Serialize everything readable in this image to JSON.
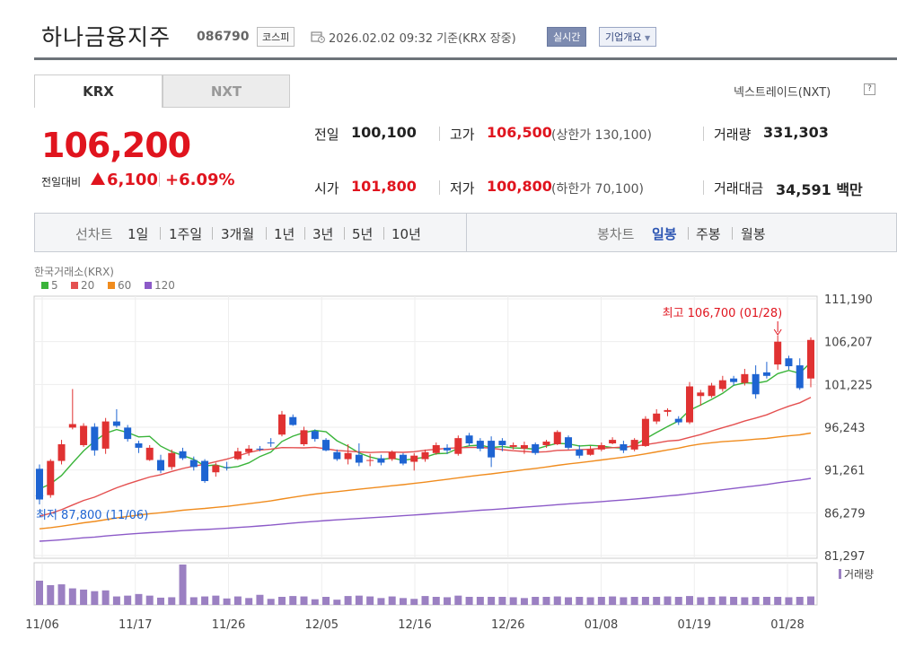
{
  "header": {
    "company": "하나금융지주",
    "code": "086790",
    "market": "코스피",
    "timestamp": "2026.02.02 09:32 기준(KRX 장중)",
    "realtime": "실시간",
    "overview": "기업개요"
  },
  "tabs": {
    "krx": "KRX",
    "nxt": "NXT"
  },
  "nxt_link": "넥스트레이드(NXT)",
  "nxt_help": "?",
  "price": {
    "current": "106,200",
    "change_label": "전일대비",
    "change": "6,100",
    "change_pct": "+6.09%"
  },
  "stats": {
    "prev_label": "전일",
    "prev": "100,100",
    "open_label": "시가",
    "open": "101,800",
    "high_label": "고가",
    "high": "106,500",
    "upper_limit": "(상한가 130,100)",
    "low_label": "저가",
    "low": "100,800",
    "lower_limit": "(하한가 70,100)",
    "volume_label": "거래량",
    "volume": "331,303",
    "amount_label": "거래대금",
    "amount": "34,591",
    "amount_unit": "백만"
  },
  "periods": {
    "line_label": "선차트",
    "items": [
      "1일",
      "1주일",
      "3개월",
      "1년",
      "3년",
      "5년",
      "10년"
    ],
    "candle_label": "봉차트",
    "candle_items": [
      "일봉",
      "주봉",
      "월봉"
    ]
  },
  "chart_data": {
    "type": "candlestick",
    "source": "한국거래소(KRX)",
    "legend": [
      {
        "name": "5",
        "color": "#3ab43a"
      },
      {
        "name": "20",
        "color": "#e45050"
      },
      {
        "name": "60",
        "color": "#f08c1e"
      },
      {
        "name": "120",
        "color": "#8c5ac8"
      }
    ],
    "y_ticks": [
      "111,190",
      "106,207",
      "101,225",
      "96,243",
      "91,261",
      "86,279",
      "81,297"
    ],
    "ylim": [
      81297,
      111190
    ],
    "x_labels": [
      "11/06",
      "11/17",
      "11/26",
      "12/05",
      "12/16",
      "12/26",
      "01/08",
      "01/19",
      "01/28"
    ],
    "high_annotation": "최고 106,700 (01/28)",
    "low_annotation": "최저 87,800 (11/06)",
    "volume_label": "거래량",
    "candles": [
      [
        91500,
        88000,
        92000,
        87800
      ],
      [
        88500,
        92400,
        92600,
        88200
      ],
      [
        92400,
        94300,
        94800,
        92000
      ],
      [
        96200,
        96600,
        100600,
        96000
      ],
      [
        94200,
        96400,
        96700,
        94000
      ],
      [
        96300,
        93600,
        96700,
        93000
      ],
      [
        93800,
        96900,
        97300,
        93200
      ],
      [
        96900,
        96400,
        98300,
        96200
      ],
      [
        96200,
        94900,
        96500,
        94600
      ],
      [
        94400,
        93900,
        94700,
        93300
      ],
      [
        92500,
        93900,
        94200,
        92400
      ],
      [
        92500,
        91300,
        93100,
        91000
      ],
      [
        91700,
        93300,
        93700,
        91400
      ],
      [
        93500,
        92700,
        93900,
        92500
      ],
      [
        92500,
        91700,
        92900,
        91300
      ],
      [
        92400,
        90100,
        92600,
        89900
      ],
      [
        91100,
        91900,
        92200,
        90600
      ],
      [
        91700,
        91600,
        92300,
        91300
      ],
      [
        92600,
        93500,
        93900,
        92500
      ],
      [
        93400,
        93800,
        94200,
        93000
      ],
      [
        93800,
        93700,
        94100,
        93500
      ],
      [
        94500,
        94400,
        95000,
        94000
      ],
      [
        95400,
        97700,
        98100,
        95200
      ],
      [
        97400,
        96500,
        97700,
        96400
      ],
      [
        94300,
        95900,
        96300,
        94100
      ],
      [
        95800,
        94900,
        96000,
        94600
      ],
      [
        94800,
        93600,
        95000,
        93500
      ],
      [
        93400,
        92600,
        93700,
        92400
      ],
      [
        92600,
        93300,
        94300,
        92000
      ],
      [
        93100,
        92200,
        94400,
        91800
      ],
      [
        92400,
        92500,
        93200,
        91800
      ],
      [
        92700,
        92200,
        93100,
        91900
      ],
      [
        92600,
        93400,
        93600,
        92400
      ],
      [
        93100,
        92100,
        93300,
        91900
      ],
      [
        92300,
        93000,
        93300,
        91300
      ],
      [
        92600,
        93400,
        93700,
        92300
      ],
      [
        93300,
        94200,
        94500,
        93100
      ],
      [
        93900,
        93600,
        94300,
        93200
      ],
      [
        93200,
        95000,
        95300,
        93000
      ],
      [
        95300,
        94400,
        95600,
        94100
      ],
      [
        94700,
        93800,
        95000,
        93500
      ],
      [
        94700,
        92800,
        95200,
        91700
      ],
      [
        94700,
        94200,
        95000,
        93500
      ],
      [
        94000,
        94200,
        94500,
        93700
      ],
      [
        93800,
        94200,
        94600,
        93200
      ],
      [
        94300,
        93300,
        94500,
        93100
      ],
      [
        94200,
        94600,
        94800,
        93900
      ],
      [
        94300,
        95700,
        95900,
        94200
      ],
      [
        95100,
        93900,
        95300,
        93700
      ],
      [
        93700,
        93000,
        94200,
        92700
      ],
      [
        93100,
        93700,
        94100,
        93000
      ],
      [
        93700,
        94200,
        94500,
        93500
      ],
      [
        94400,
        94800,
        95100,
        94300
      ],
      [
        94300,
        93600,
        94700,
        93300
      ],
      [
        93700,
        94800,
        95000,
        93500
      ],
      [
        94100,
        97200,
        97500,
        94000
      ],
      [
        96900,
        97800,
        98300,
        96600
      ],
      [
        98000,
        98200,
        98400,
        97500
      ],
      [
        97200,
        96800,
        97500,
        96500
      ],
      [
        96800,
        100900,
        101400,
        96600
      ],
      [
        99800,
        100200,
        100500,
        98700
      ],
      [
        99800,
        101000,
        101300,
        99600
      ],
      [
        100600,
        101600,
        102100,
        100300
      ],
      [
        101800,
        101400,
        102100,
        101000
      ],
      [
        101300,
        102300,
        102900,
        101000
      ],
      [
        102300,
        100000,
        103300,
        99500
      ],
      [
        102500,
        102100,
        103700,
        101800
      ],
      [
        103400,
        106000,
        106700,
        102800
      ],
      [
        104100,
        103200,
        104400,
        102800
      ],
      [
        103300,
        100700,
        104100,
        100500
      ],
      [
        101800,
        106200,
        106500,
        100800
      ]
    ],
    "volumes": [
      0.6,
      0.49,
      0.51,
      0.41,
      0.38,
      0.34,
      0.36,
      0.21,
      0.23,
      0.27,
      0.23,
      0.18,
      0.19,
      1.0,
      0.19,
      0.21,
      0.23,
      0.16,
      0.21,
      0.17,
      0.25,
      0.15,
      0.2,
      0.22,
      0.21,
      0.14,
      0.2,
      0.13,
      0.22,
      0.23,
      0.21,
      0.17,
      0.21,
      0.17,
      0.15,
      0.22,
      0.2,
      0.19,
      0.23,
      0.2,
      0.2,
      0.2,
      0.2,
      0.19,
      0.17,
      0.2,
      0.2,
      0.21,
      0.19,
      0.2,
      0.19,
      0.2,
      0.21,
      0.19,
      0.2,
      0.2,
      0.2,
      0.21,
      0.2,
      0.22,
      0.19,
      0.2,
      0.21,
      0.2,
      0.19,
      0.2,
      0.2,
      0.2,
      0.19,
      0.2,
      0.21
    ]
  }
}
